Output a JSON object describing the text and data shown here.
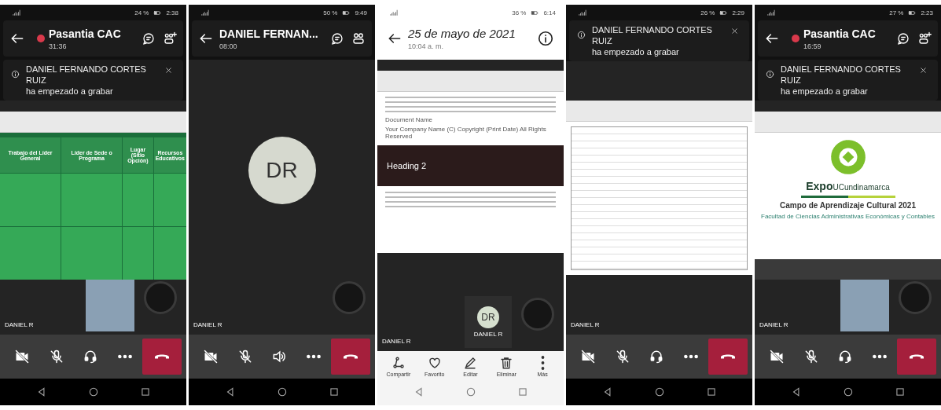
{
  "phones": [
    {
      "kind": "call",
      "status": {
        "battery": "24 %",
        "time": "2:38"
      },
      "header": {
        "kind": "call",
        "title": "Pasantia CAC",
        "subtitle": "31:36",
        "recording": true,
        "add_people": true
      },
      "banner": {
        "name": "DANIEL FERNANDO CORTES RUIZ",
        "message": "ha empezado a grabar"
      },
      "stage": {
        "kind": "spreadsheet",
        "headers": [
          "Trabajo del Líder General",
          "Líder de Sede o Programa",
          "Lugar (Sitio Opción)",
          "Recursos Educativos"
        ]
      },
      "participant_label": "DANIEL R",
      "tiles": [
        {
          "kind": "video"
        },
        {
          "kind": "photo"
        }
      ],
      "controls": {
        "camera_on": false,
        "mic_on": false,
        "audio": {
          "kind": "headset"
        }
      }
    },
    {
      "kind": "call",
      "status": {
        "battery": "50 %",
        "time": "9:49"
      },
      "header": {
        "kind": "call",
        "title": "DANIEL FERNAN...",
        "subtitle": "08:00",
        "recording": false,
        "add_people": false
      },
      "stage": {
        "kind": "avatar",
        "initials": "DR"
      },
      "participant_label": "DANIEL R",
      "tiles": [
        {
          "kind": "photo"
        }
      ],
      "controls": {
        "camera_on": false,
        "mic_on": false,
        "audio": {
          "kind": "speaker"
        }
      }
    },
    {
      "kind": "gallery",
      "status": {
        "battery": "36 %",
        "time": "6:14"
      },
      "header": {
        "kind": "gallery",
        "title": "25 de mayo de 2021",
        "subtitle": "10:04 a. m."
      },
      "stage": {
        "kind": "document",
        "title": "Document Name",
        "footer": "Your Company Name (C) Copyright (Print Date) All Rights Reserved",
        "heading": "Heading 2"
      },
      "participant_label": "DANIEL R",
      "tiles": [
        {
          "kind": "initials",
          "initials": "DR",
          "name": "DANIEL R"
        },
        {
          "kind": "photo"
        }
      ],
      "toolbar": [
        {
          "kind": "share",
          "label": "Compartir"
        },
        {
          "kind": "favorite",
          "label": "Favorito"
        },
        {
          "kind": "edit",
          "label": "Editar"
        },
        {
          "kind": "delete",
          "label": "Eliminar"
        },
        {
          "kind": "more",
          "label": "Más"
        }
      ]
    },
    {
      "kind": "call",
      "status": {
        "battery": "26 %",
        "time": "2:29"
      },
      "banner": {
        "name": "DANIEL FERNANDO CORTES RUIZ",
        "message": "ha empezado a grabar"
      },
      "stage": {
        "kind": "table"
      },
      "participant_label": "DANIEL R",
      "controls": {
        "camera_on": false,
        "mic_on": false,
        "audio": {
          "kind": "headset"
        }
      }
    },
    {
      "kind": "call",
      "status": {
        "battery": "27 %",
        "time": "2:23"
      },
      "header": {
        "kind": "call",
        "title": "Pasantia CAC",
        "subtitle": "16:59",
        "recording": true,
        "add_people": true
      },
      "banner": {
        "name": "DANIEL FERNANDO CORTES RUIZ",
        "message": "ha empezado a grabar"
      },
      "stage": {
        "kind": "slides",
        "logo_bold": "Expo",
        "logo_text": "UCundinamarca",
        "title": "Campo de Aprendizaje Cultural  2021",
        "subtitle": "Facultad de Ciencias Administrativas Económicas y Contables"
      },
      "participant_label": "DANIEL R",
      "tiles": [
        {
          "kind": "video"
        },
        {
          "kind": "photo"
        }
      ],
      "controls": {
        "camera_on": false,
        "mic_on": false,
        "audio": {
          "kind": "headset"
        }
      }
    }
  ]
}
